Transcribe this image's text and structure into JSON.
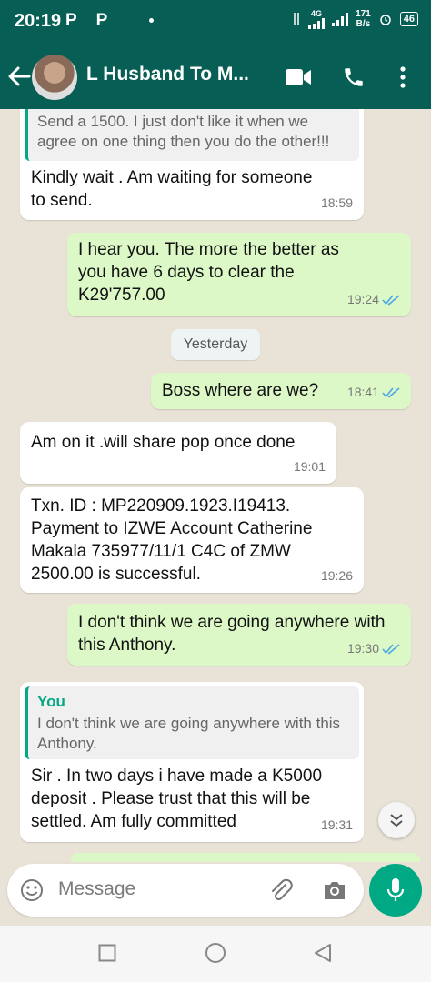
{
  "status_bar": {
    "time": "20:19",
    "app_indicators": "P P",
    "network_type": "4G",
    "speed_value": "171",
    "speed_unit": "B/s",
    "battery": "46"
  },
  "header": {
    "contact_name": "L Husband To M...",
    "icons": [
      "back-arrow-icon",
      "video-call-icon",
      "voice-call-icon",
      "more-options-icon"
    ]
  },
  "messages": [
    {
      "direction": "in",
      "quoted_text": "Send a 1500. I just don't like it when we agree on one thing then you do the other!!!",
      "text": "Kindly wait . Am waiting for someone to send.",
      "time": "18:59"
    },
    {
      "direction": "out",
      "text": "I hear you. The more the better as you have 6 days to clear the K29'757.00",
      "time": "19:24",
      "read": true
    },
    {
      "date_separator": "Yesterday"
    },
    {
      "direction": "out",
      "text": "Boss where are we?",
      "time": "18:41",
      "read": true
    },
    {
      "direction": "in",
      "text": "Am on it .will share pop once done",
      "time": "19:01"
    },
    {
      "direction": "in",
      "text": "Txn. ID : MP220909.1923.I19413. Payment to IZWE Account Catherine Makala 735977/11/1 C4C of ZMW 2500.00 is successful.",
      "time": "19:26"
    },
    {
      "direction": "out",
      "text": "I don't think we are going anywhere with this Anthony.",
      "time": "19:30",
      "read": true
    },
    {
      "direction": "in",
      "quoted_author": "You",
      "quoted_text": "I don't think we are going anywhere with this Anthony.",
      "text": "Sir . In two days i have made a K5000 deposit . Please trust that this will be settled. Am fully committed",
      "time": "19:31"
    }
  ],
  "composer": {
    "placeholder": "Message",
    "icons": [
      "emoji-icon",
      "attach-icon",
      "camera-icon",
      "mic-icon"
    ]
  },
  "colors": {
    "header": "#075e54",
    "outgoing_bubble": "#dcf8c6",
    "incoming_bubble": "#ffffff",
    "accent": "#00a884",
    "read_ticks": "#4fa9e6"
  }
}
